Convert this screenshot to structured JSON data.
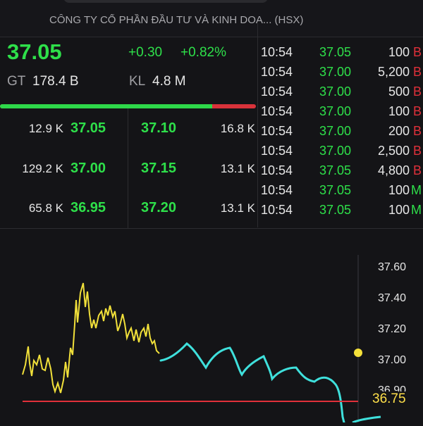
{
  "header": {
    "company": "CÔNG TY CỔ PHẦN ĐẦU TƯ VÀ KINH DOA... (HSX)"
  },
  "quote": {
    "price": "37.05",
    "change": "+0.30",
    "change_pct": "+0.82%",
    "gt_label": "GT",
    "gt_value": "178.4 B",
    "kl_label": "KL",
    "kl_value": "4.8 M",
    "buy_ratio": 0.83,
    "colors": {
      "up": "#2ee04a",
      "down": "#d8323a"
    }
  },
  "orderbook": [
    {
      "bid_vol": "12.9 K",
      "bid": "37.05",
      "ask": "37.10",
      "ask_vol": "16.8 K"
    },
    {
      "bid_vol": "129.2 K",
      "bid": "37.00",
      "ask": "37.15",
      "ask_vol": "13.1 K"
    },
    {
      "bid_vol": "65.8 K",
      "bid": "36.95",
      "ask": "37.20",
      "ask_vol": "13.1 K"
    }
  ],
  "trades": [
    {
      "time": "10:54",
      "price": "37.05",
      "vol": "100",
      "side": "B"
    },
    {
      "time": "10:54",
      "price": "37.00",
      "vol": "5,200",
      "side": "B"
    },
    {
      "time": "10:54",
      "price": "37.00",
      "vol": "500",
      "side": "B"
    },
    {
      "time": "10:54",
      "price": "37.00",
      "vol": "100",
      "side": "B"
    },
    {
      "time": "10:54",
      "price": "37.00",
      "vol": "200",
      "side": "B"
    },
    {
      "time": "10:54",
      "price": "37.00",
      "vol": "2,500",
      "side": "B"
    },
    {
      "time": "10:54",
      "price": "37.05",
      "vol": "4,800",
      "side": "B"
    },
    {
      "time": "10:54",
      "price": "37.05",
      "vol": "100",
      "side": "M"
    },
    {
      "time": "10:54",
      "price": "37.05",
      "vol": "100",
      "side": "M"
    }
  ],
  "chart": {
    "ticks": [
      "37.60",
      "37.40",
      "37.20",
      "37.00",
      "36.90"
    ],
    "reference_price": "36.75",
    "colors": {
      "price": "#f1e03a",
      "projection": "#3fe0dc",
      "reference": "#e0303a",
      "marker": "#f5e13a"
    }
  }
}
